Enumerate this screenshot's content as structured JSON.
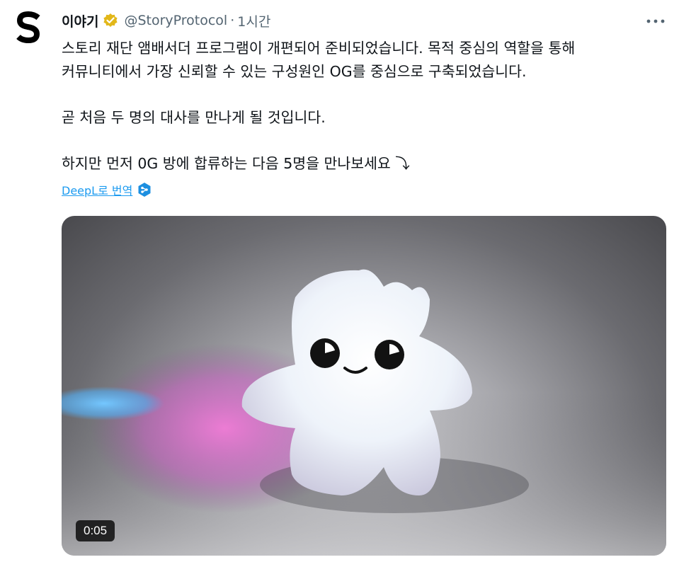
{
  "tweet": {
    "author_name": "이야기",
    "handle": "@StoryProtocol",
    "separator": "·",
    "time": "1시간",
    "paragraphs": [
      [
        "스토리 재단 앰배서더 프로그램이 개편되어 준비되었습니다. 목적 중심의 역할을 통해",
        "커뮤니티에서 가장 신뢰할 수 있는 구성원인 OG를 중심으로 구축되었습니다."
      ],
      [
        "곧 처음 두 명의 대사를 만나게 될 것입니다."
      ],
      [
        "하지만 먼저 0G 방에 합류하는 다음 5명을 만나보세요 ⤵"
      ]
    ],
    "translate_label": "DeepL로 번역",
    "video": {
      "duration": "0:05"
    }
  },
  "colors": {
    "verified_badge": "#e2b719",
    "link": "#1d9bf0",
    "secondary_text": "#536471"
  },
  "icons": {
    "avatar": "story-logo-icon",
    "verified": "verified-badge-icon",
    "more": "more-dots-icon",
    "deepl": "deepl-icon"
  }
}
